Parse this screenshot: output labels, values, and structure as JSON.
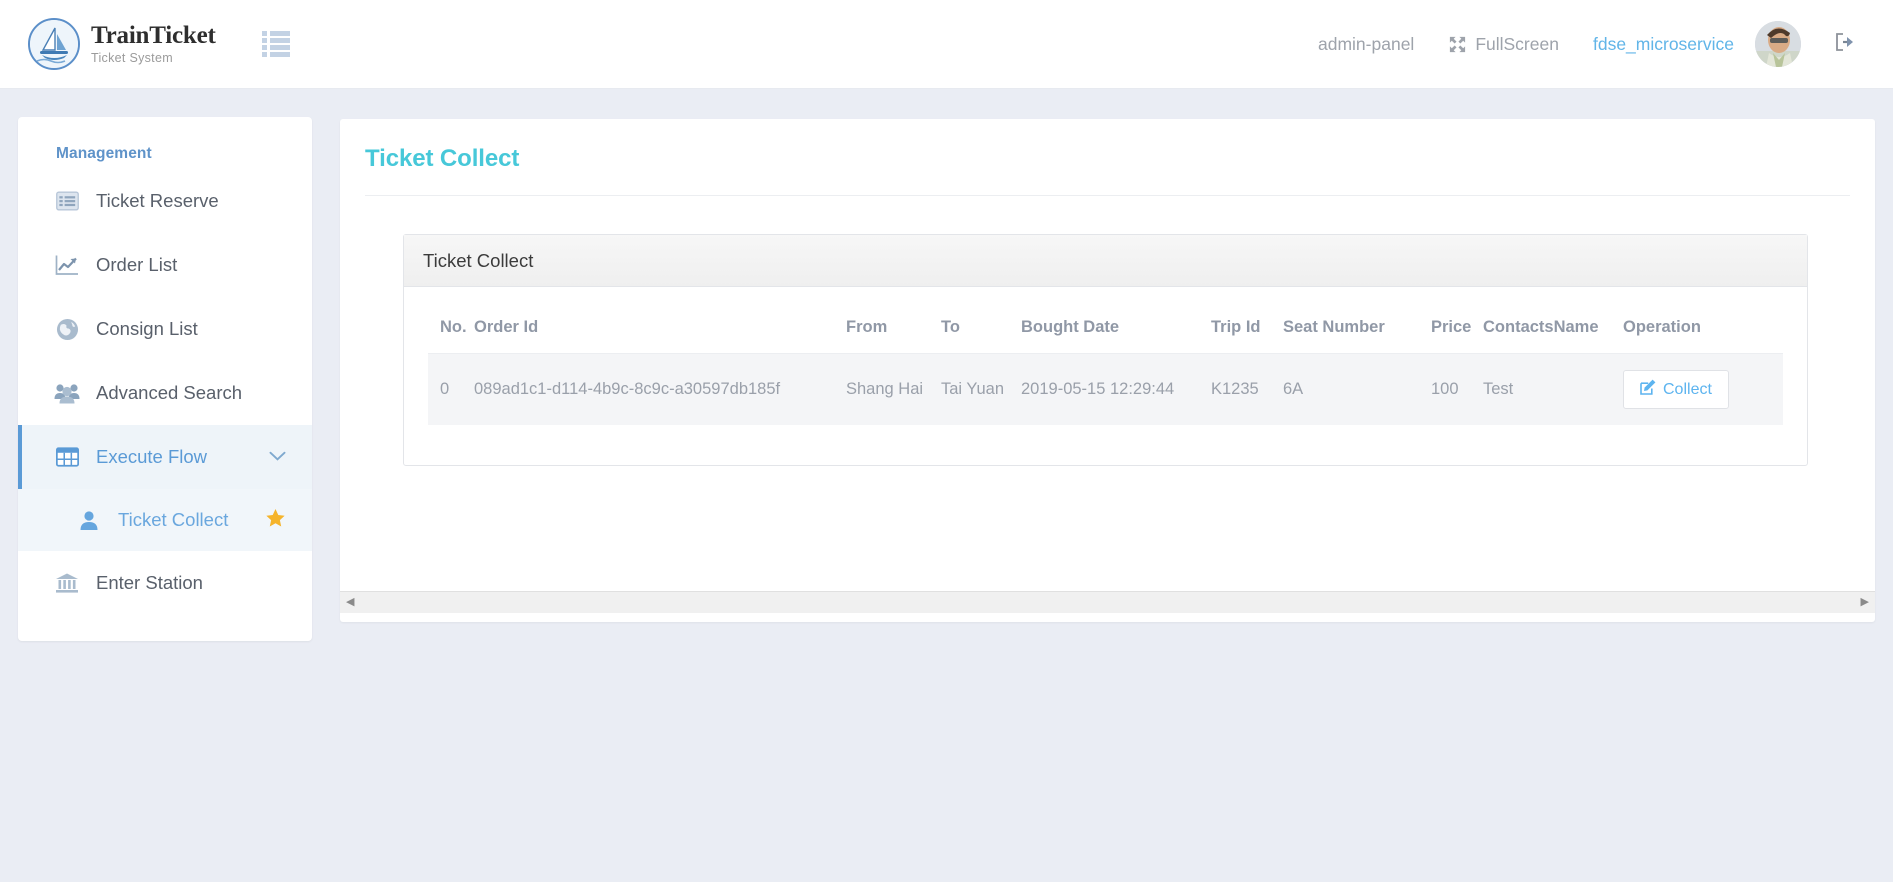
{
  "header": {
    "brand_title": "TrainTicket",
    "brand_subtitle": "Ticket System",
    "menu_toggle_icon": "list-menu-icon",
    "logo_icon": "sailboat-icon",
    "nav": {
      "admin_panel": "admin-panel",
      "fullscreen": "FullScreen",
      "fullscreen_icon": "expand-arrows-icon",
      "username": "fdse_microservice",
      "avatar_icon": "user-avatar-photo",
      "logout_icon": "sign-out-icon"
    }
  },
  "sidebar": {
    "section_title": "Management",
    "items": [
      {
        "label": "Ticket Reserve",
        "icon": "list-alt-icon",
        "state": "normal"
      },
      {
        "label": "Order List",
        "icon": "line-chart-icon",
        "state": "normal"
      },
      {
        "label": "Consign List",
        "icon": "globe-icon",
        "state": "normal"
      },
      {
        "label": "Advanced Search",
        "icon": "users-icon",
        "state": "normal"
      },
      {
        "label": "Execute Flow",
        "icon": "table-grid-icon",
        "state": "active",
        "chevron": "chevron-down-icon"
      },
      {
        "label": "Ticket Collect",
        "icon": "user-icon",
        "state": "sub-active",
        "star": "star-icon"
      },
      {
        "label": "Enter Station",
        "icon": "bank-icon",
        "state": "sub"
      }
    ]
  },
  "main": {
    "page_title": "Ticket Collect",
    "panel_title": "Ticket Collect",
    "table": {
      "columns": [
        "No.",
        "Order Id",
        "From",
        "To",
        "Bought Date",
        "Trip Id",
        "Seat Number",
        "Price",
        "ContactsName",
        "Operation"
      ],
      "rows": [
        {
          "no": "0",
          "order_id": "089ad1c1-d114-4b9c-8c9c-a30597db185f",
          "from": "Shang Hai",
          "to": "Tai Yuan",
          "bought_date": "2019-05-15 12:29:44",
          "trip_id": "K1235",
          "seat_number": "6A",
          "price": "100",
          "contacts_name": "Test",
          "operation_label": "Collect",
          "operation_icon": "edit-square-icon"
        }
      ]
    }
  },
  "scrollbar": {
    "left_arrow": "◀",
    "right_arrow": "▶"
  },
  "colors": {
    "accent_cyan": "#47c8d9",
    "link_blue": "#61b5e8",
    "active_blue": "#5a9ad6",
    "star_gold": "#f5b42b",
    "page_bg": "#eaedf4"
  }
}
